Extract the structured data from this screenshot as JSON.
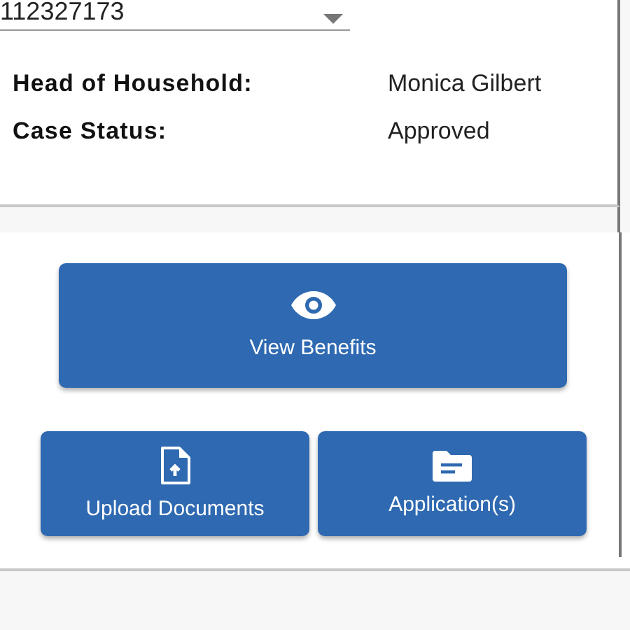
{
  "case_select": {
    "value": "112327173"
  },
  "details": [
    {
      "label": "Head of Household:",
      "value": "Monica Gilbert"
    },
    {
      "label": "Case Status:",
      "value": "Approved"
    }
  ],
  "primary_action": {
    "label": "View Benefits"
  },
  "actions": [
    {
      "label": "Upload Documents"
    },
    {
      "label": "Application(s)"
    }
  ]
}
